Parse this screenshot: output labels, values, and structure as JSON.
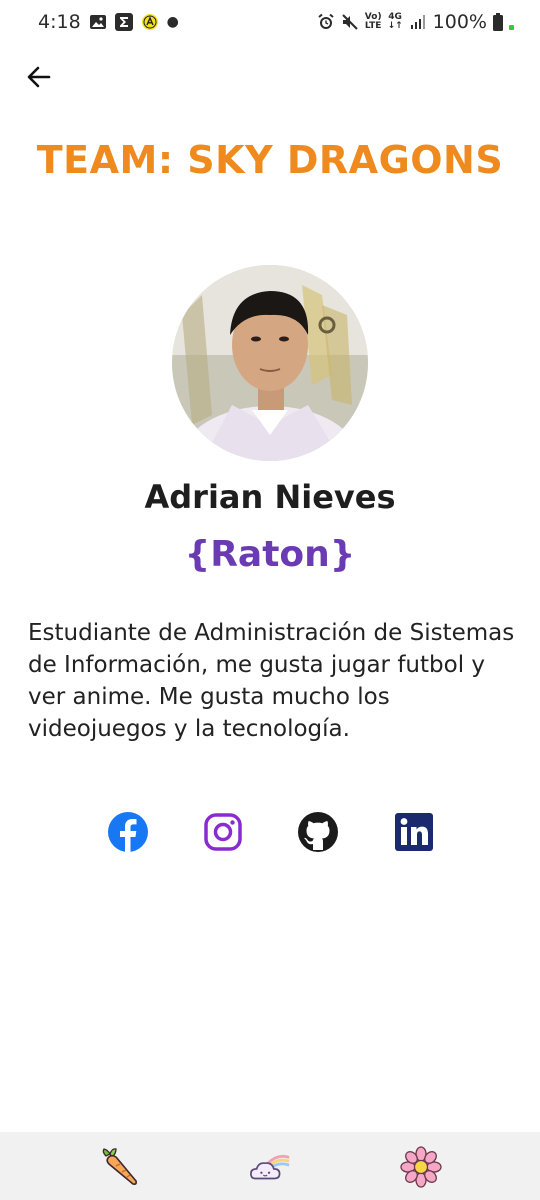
{
  "status_bar": {
    "time": "4:18",
    "battery": "100%",
    "network": "4G"
  },
  "header": {
    "team_title": "TEAM: SKY DRAGONS"
  },
  "profile": {
    "name": "Adrian Nieves",
    "nickname": "{Raton}",
    "bio": "Estudiante de Administración de Sistemas de Información, me gusta jugar futbol y ver anime. Me gusta mucho los videojuegos y la tecnología."
  },
  "social": [
    {
      "icon": "facebook-icon",
      "color": "#1877f2"
    },
    {
      "icon": "instagram-icon",
      "color": "#8a2bd0"
    },
    {
      "icon": "github-icon",
      "color": "#1b1b1b"
    },
    {
      "icon": "linkedin-icon",
      "color": "#1a2a6c"
    }
  ],
  "bottom_nav": {
    "items": [
      {
        "icon": "carrot-icon"
      },
      {
        "icon": "rainbow-cloud-icon"
      },
      {
        "icon": "flower-icon"
      }
    ]
  },
  "colors": {
    "accent_orange": "#ee8a1e",
    "accent_purple": "#6a3bb2"
  }
}
